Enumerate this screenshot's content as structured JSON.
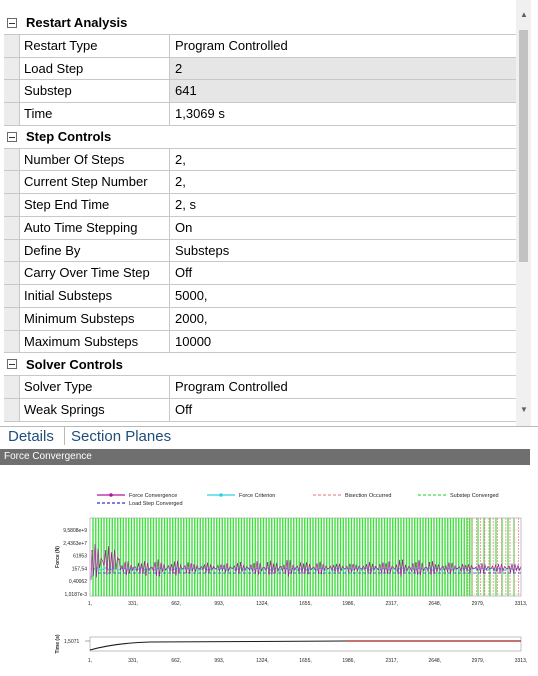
{
  "details": {
    "groups": [
      {
        "title": "Restart Analysis",
        "rows": [
          {
            "name": "Restart Type",
            "value": "Program Controlled",
            "readonly": false
          },
          {
            "name": "Load Step",
            "value": "2",
            "readonly": true
          },
          {
            "name": "Substep",
            "value": "641",
            "readonly": true
          },
          {
            "name": "Time",
            "value": "1,3069 s",
            "readonly": false
          }
        ]
      },
      {
        "title": "Step Controls",
        "rows": [
          {
            "name": "Number Of Steps",
            "value": "2,",
            "readonly": false
          },
          {
            "name": "Current Step Number",
            "value": "2,",
            "readonly": false
          },
          {
            "name": "Step End Time",
            "value": "2, s",
            "readonly": false
          },
          {
            "name": "Auto Time Stepping",
            "value": "On",
            "readonly": false
          },
          {
            "name": "Define By",
            "value": "Substeps",
            "readonly": false
          },
          {
            "name": "Carry Over Time Step",
            "value": "Off",
            "readonly": false
          },
          {
            "name": "Initial Substeps",
            "value": "5000,",
            "readonly": false
          },
          {
            "name": "Minimum Substeps",
            "value": "2000,",
            "readonly": false
          },
          {
            "name": "Maximum Substeps",
            "value": "10000",
            "readonly": false
          }
        ]
      },
      {
        "title": "Solver Controls",
        "rows": [
          {
            "name": "Solver Type",
            "value": "Program Controlled",
            "readonly": false
          },
          {
            "name": "Weak Springs",
            "value": "Off",
            "readonly": false
          }
        ]
      }
    ],
    "tabs": [
      {
        "label": "Details"
      },
      {
        "label": "Section Planes"
      }
    ]
  },
  "force_convergence": {
    "title": "Force Convergence",
    "colors": {
      "force_convergence": "#b0179d",
      "force_criterion": "#2fd0e0",
      "bisection": "#ef8a8a",
      "substep_converged": "#3ee03e",
      "load_step_converged": "#3434c8",
      "time_curve": "#1a1a1a",
      "time_curve_step2": "#9b2020"
    },
    "chart_data": [
      {
        "type": "line",
        "title": "",
        "ylabel": "Force (N)",
        "xlabel": "",
        "legend_position": "top",
        "x_ticks": [
          "1,",
          "331,",
          "662,",
          "993,",
          "1324,",
          "1655,",
          "1986,",
          "2317,",
          "2648,",
          "2979,",
          "3313,"
        ],
        "y_ticks": [
          "9,5808e+9",
          "2,4363e+7",
          "61953",
          "157,54",
          "0,40062",
          "1,0187e-3"
        ],
        "y_scale": "log",
        "xlim": [
          1,
          3313
        ],
        "series": [
          {
            "name": "Force Convergence",
            "marker": "circle",
            "style": "solid"
          },
          {
            "name": "Force Criterion",
            "marker": "circle",
            "style": "solid"
          },
          {
            "name": "Bisection Occurred",
            "style": "dashed"
          },
          {
            "name": "Substep Converged",
            "style": "dashed"
          },
          {
            "name": "Load Step Converged",
            "style": "dashed"
          }
        ]
      },
      {
        "type": "line",
        "ylabel": "Time (s)",
        "xlabel": "",
        "x_ticks": [
          "1,",
          "331,",
          "662,",
          "993,",
          "1324,",
          "1655,",
          "1986,",
          "2317,",
          "2648,",
          "2979,",
          "3313,"
        ],
        "y_ticks": [
          "1,5071"
        ],
        "xlim": [
          1,
          3313
        ]
      }
    ]
  }
}
